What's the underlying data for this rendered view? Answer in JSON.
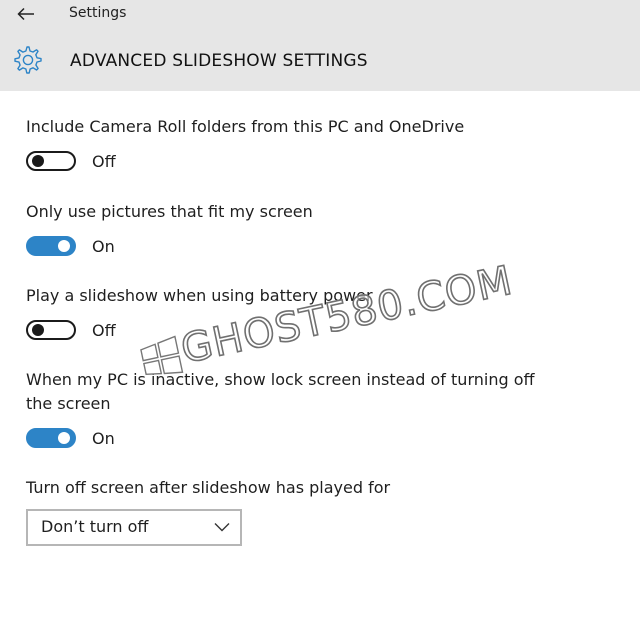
{
  "window": {
    "title": "Settings"
  },
  "header": {
    "page_title": "ADVANCED SLIDESHOW SETTINGS",
    "icon": "gear-icon",
    "back_icon": "back-arrow-icon"
  },
  "settings": [
    {
      "label": "Include Camera Roll folders from this PC and OneDrive",
      "state": "Off",
      "on": false
    },
    {
      "label": "Only use pictures that fit my screen",
      "state": "On",
      "on": true
    },
    {
      "label": "Play a slideshow when using battery power",
      "state": "Off",
      "on": false
    },
    {
      "label": "When my PC is inactive, show lock screen instead of turning off the screen",
      "state": "On",
      "on": true
    }
  ],
  "turn_off": {
    "label": "Turn off screen after slideshow has played for",
    "selected": "Don’t turn off"
  },
  "watermark": {
    "text": "GHOST580.COM"
  },
  "colors": {
    "header_bg": "#e6e6e6",
    "accent": "#2d84c7",
    "toggle_off": "#1b1b1b",
    "dropdown_border": "#b6b6b6"
  }
}
